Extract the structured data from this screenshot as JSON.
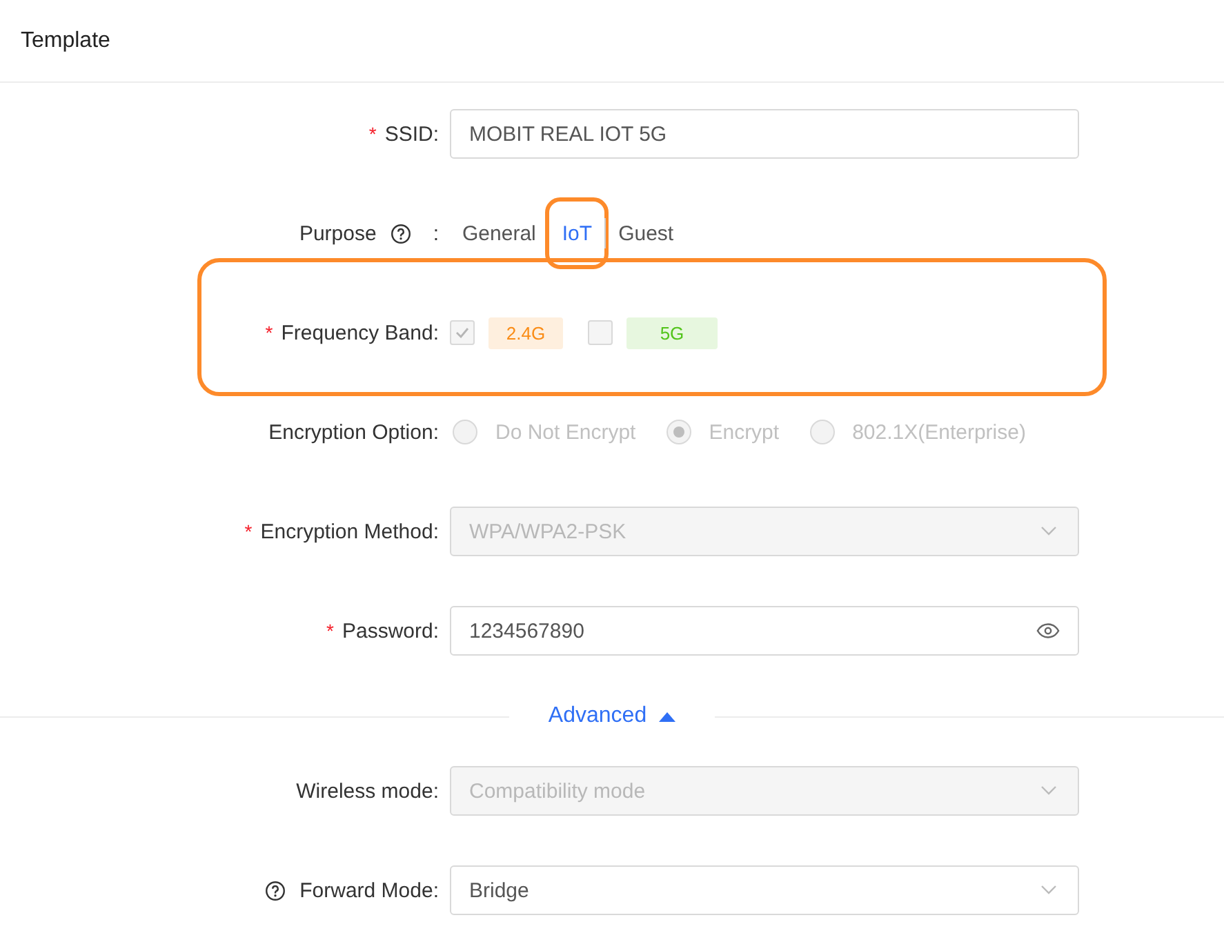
{
  "header": {
    "title": "Template"
  },
  "fields": [
    {
      "kind": "text",
      "mark": "*",
      "label": "SSID:",
      "value": "MOBIT REAL IOT 5G"
    },
    {
      "kind": "segments",
      "label": "Purpose",
      "help": true,
      "colon": ":",
      "options": [
        {
          "label": "General",
          "selected": false,
          "highlighted": false
        },
        {
          "label": "IoT",
          "selected": true,
          "highlighted": true
        },
        {
          "label": "Guest",
          "selected": false,
          "highlighted": false
        }
      ]
    },
    {
      "kind": "checkboxes",
      "mark": "*",
      "label": "Frequency Band:",
      "highlighted": true,
      "options": [
        {
          "label": "2.4G",
          "checked": true,
          "disabled": true,
          "color": "#fa8c16"
        },
        {
          "label": "5G",
          "checked": false,
          "disabled": true,
          "color": "#52c41a"
        }
      ]
    },
    {
      "kind": "radios",
      "label": "Encryption Option:",
      "disabled": true,
      "options": [
        {
          "label": "Do Not Encrypt",
          "selected": false
        },
        {
          "label": "Encrypt",
          "selected": true
        },
        {
          "label": "802.1X(Enterprise)",
          "selected": false
        }
      ]
    },
    {
      "kind": "select",
      "mark": "*",
      "label": "Encryption Method:",
      "disabled": true,
      "value": "WPA/WPA2-PSK"
    },
    {
      "kind": "password",
      "mark": "*",
      "label": "Password:",
      "value": "1234567890"
    }
  ],
  "advanced": {
    "label": "Advanced",
    "expanded": true
  },
  "advanced_fields": [
    {
      "kind": "select",
      "label": "Wireless mode:",
      "disabled": true,
      "value": "Compatibility mode"
    },
    {
      "kind": "select",
      "label": "Forward Mode:",
      "help": true,
      "value": "Bridge"
    }
  ]
}
